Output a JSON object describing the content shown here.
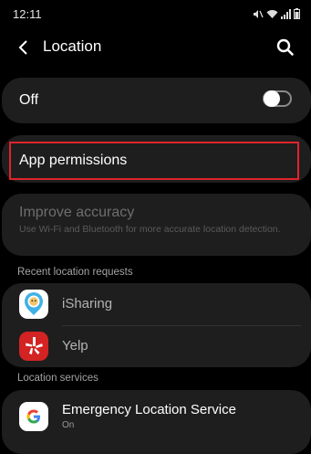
{
  "status_bar": {
    "time": "12:11",
    "icons": [
      "mute-icon",
      "wifi-icon",
      "signal-icon",
      "battery-icon"
    ]
  },
  "header": {
    "title": "Location",
    "back_icon": "back-arrow-icon",
    "search_icon": "search-icon"
  },
  "location_toggle": {
    "label": "Off",
    "state": "off"
  },
  "app_permissions": {
    "label": "App permissions",
    "highlight_color": "#e0242b"
  },
  "improve_accuracy": {
    "title": "Improve accuracy",
    "description": "Use Wi-Fi and Bluetooth for more accurate location detection."
  },
  "recent_requests": {
    "header": "Recent location requests",
    "apps": [
      {
        "name": "iSharing",
        "icon": "isharing-app-icon"
      },
      {
        "name": "Yelp",
        "icon": "yelp-app-icon"
      }
    ]
  },
  "location_services": {
    "header": "Location services",
    "items": [
      {
        "title": "Emergency Location Service",
        "status": "On",
        "icon": "google-icon"
      }
    ]
  },
  "colors": {
    "background": "#000000",
    "card": "#1e1e1e",
    "yelp_red": "#d32323"
  }
}
